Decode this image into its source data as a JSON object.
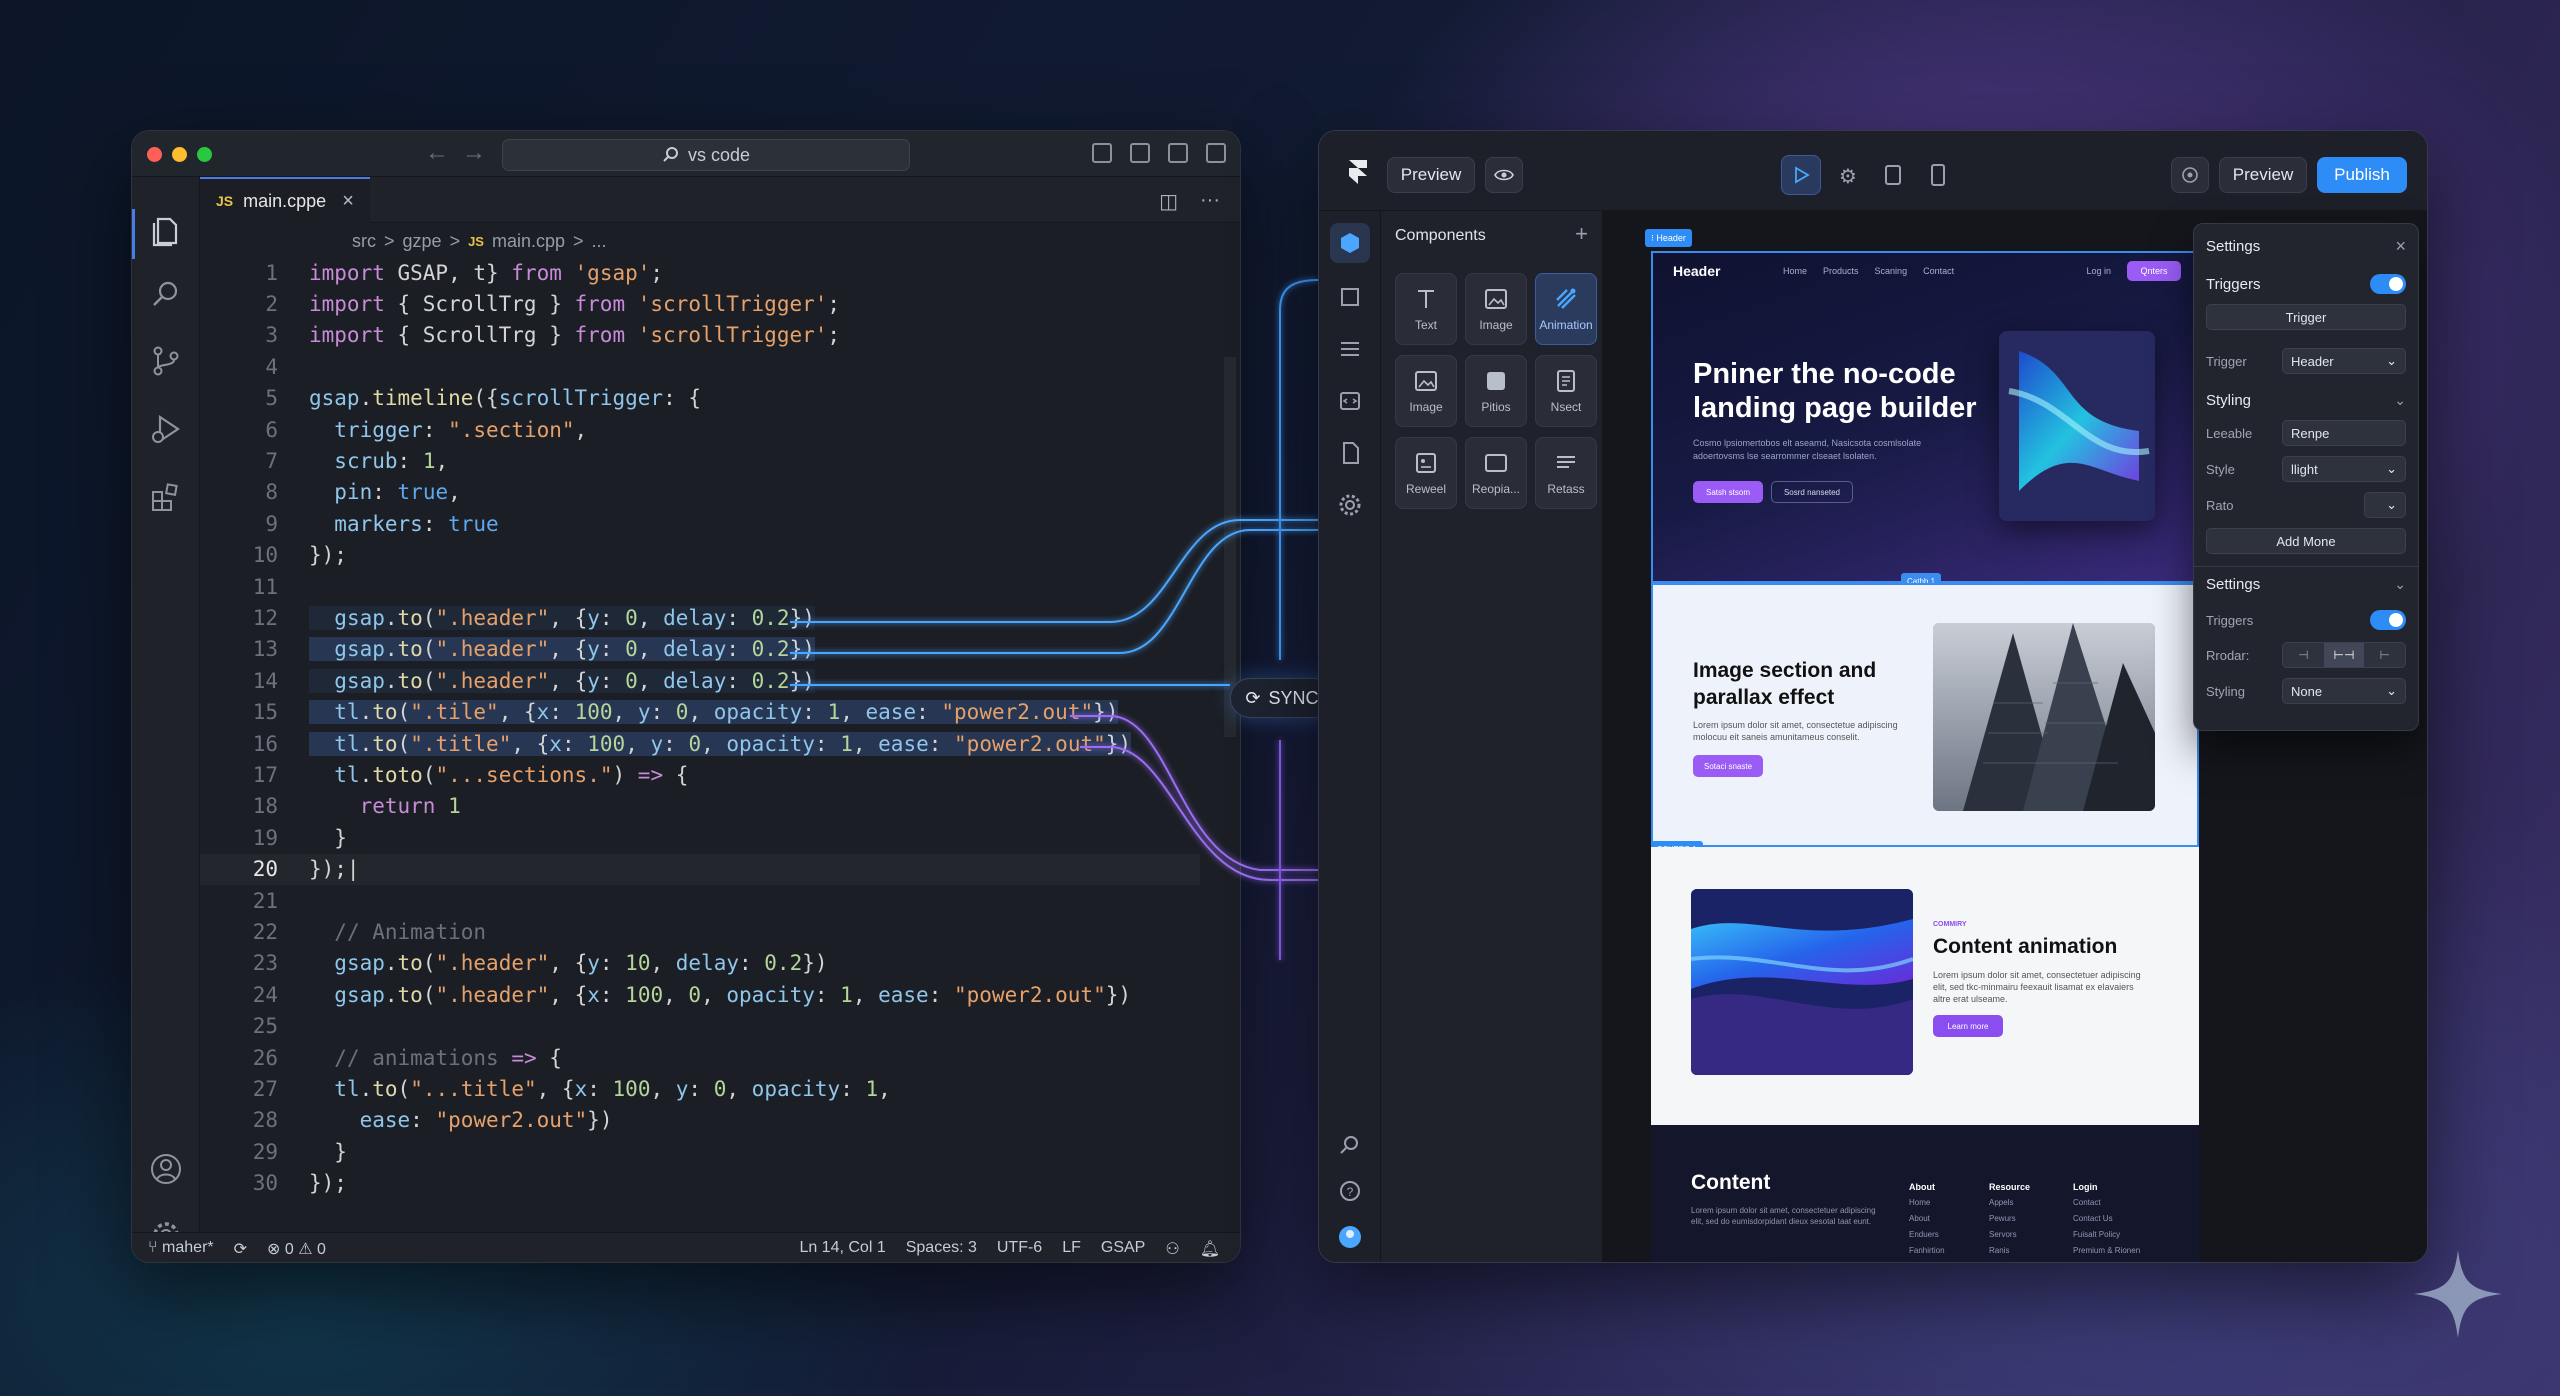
{
  "editor": {
    "title_search": "vs code",
    "tab_label": "main.cppe",
    "tab_badge": "JS",
    "breadcrumb": [
      "src",
      ">",
      "gzpe",
      ">",
      "JS",
      "main.cpp",
      ">",
      "..."
    ],
    "active_line": 20,
    "lines": [
      {
        "n": 1,
        "html": "<span class='kw'>import</span> GSAP, t} <span class='kw'>from</span> <span class='str'>'gsap'</span>;"
      },
      {
        "n": 2,
        "html": "<span class='kw'>import</span> { ScrollTrg } <span class='kw'>from</span> <span class='str'>'scrollTrigger'</span>;"
      },
      {
        "n": 3,
        "html": "<span class='kw'>import</span> { ScrollTrg } <span class='kw'>from</span> <span class='str'>'scrollTrigger'</span>;"
      },
      {
        "n": 4,
        "html": ""
      },
      {
        "n": 5,
        "html": "<span class='var'>gsap</span>.<span class='fn'>timeline</span>({<span class='var'>scrollTrigger</span>: {"
      },
      {
        "n": 6,
        "html": "  <span class='var'>trigger</span>: <span class='str'>\".section\"</span>,"
      },
      {
        "n": 7,
        "html": "  <span class='var'>scrub</span>: <span class='num'>1</span>,"
      },
      {
        "n": 8,
        "html": "  <span class='var'>pin</span>: <span class='bool'>true</span>,"
      },
      {
        "n": 9,
        "html": "  <span class='var'>markers</span>: <span class='bool'>true</span>"
      },
      {
        "n": 10,
        "html": "});"
      },
      {
        "n": 11,
        "html": ""
      },
      {
        "n": 12,
        "hl": 1,
        "html": "  <span class='var'>gsap</span>.<span class='fn'>to</span>(<span class='str'>\".header\"</span>, {<span class='var'>y</span>: <span class='num'>0</span>, <span class='var'>delay</span>: <span class='num'>0.2</span>})"
      },
      {
        "n": 13,
        "hl": 2,
        "html": "  <span class='var'>gsap</span>.<span class='fn'>to</span>(<span class='str'>\".header\"</span>, {<span class='var'>y</span>: <span class='num'>0</span>, <span class='var'>delay</span>: <span class='num'>0.2</span>})"
      },
      {
        "n": 14,
        "hl": 1,
        "html": "  <span class='var'>gsap</span>.<span class='fn'>to</span>(<span class='str'>\".header\"</span>, {<span class='var'>y</span>: <span class='num'>0</span>, <span class='var'>delay</span>: <span class='num'>0.2</span>})"
      },
      {
        "n": 15,
        "hl": 2,
        "html": "  <span class='var'>tl</span>.<span class='fn'>to</span>(<span class='str'>\".tile\"</span>, {<span class='var'>x</span>: <span class='num'>100</span>, <span class='var'>y</span>: <span class='num'>0</span>, <span class='var'>opacity</span>: <span class='num'>1</span>, <span class='var'>ease</span>: <span class='str'>\"power2.out\"</span>})"
      },
      {
        "n": 16,
        "hl": 2,
        "html": "  <span class='var'>tl</span>.<span class='fn'>to</span>(<span class='str'>\".title\"</span>, {<span class='var'>x</span>: <span class='num'>100</span>, <span class='var'>y</span>: <span class='num'>0</span>, <span class='var'>opacity</span>: <span class='num'>1</span>, <span class='var'>ease</span>: <span class='str'>\"power2.out\"</span>})"
      },
      {
        "n": 17,
        "html": "  <span class='var'>tl</span>.<span class='fn'>toto</span>(<span class='str'>\"...sections.\"</span>) <span class='kw'>=&gt;</span> {"
      },
      {
        "n": 18,
        "html": "    <span class='kw'>return</span> <span class='num'>1</span>"
      },
      {
        "n": 19,
        "html": "  }"
      },
      {
        "n": 20,
        "html": "});|"
      },
      {
        "n": 21,
        "html": ""
      },
      {
        "n": 22,
        "html": "  <span class='cmt'>// Animation</span>"
      },
      {
        "n": 23,
        "html": "  <span class='var'>gsap</span>.<span class='fn'>to</span>(<span class='str'>\".header\"</span>, {<span class='var'>y</span>: <span class='num'>10</span>, <span class='var'>delay</span>: <span class='num'>0.2</span>})"
      },
      {
        "n": 24,
        "html": "  <span class='var'>gsap</span>.<span class='fn'>to</span>(<span class='str'>\".header\"</span>, {<span class='var'>x</span>: <span class='num'>100</span>, <span class='num'>0</span>, <span class='var'>opacity</span>: <span class='num'>1</span>, <span class='var'>ease</span>: <span class='str'>\"power2.out\"</span>})"
      },
      {
        "n": 25,
        "html": ""
      },
      {
        "n": 26,
        "html": "  <span class='cmt'>// animations</span> <span class='kw'>=&gt;</span> {"
      },
      {
        "n": 27,
        "html": "  <span class='var'>tl</span>.<span class='fn'>to</span>(<span class='str'>\"...title\"</span>, {<span class='var'>x</span>: <span class='num'>100</span>, <span class='var'>y</span>: <span class='num'>0</span>, <span class='var'>opacity</span>: <span class='num'>1</span>,"
      },
      {
        "n": 28,
        "html": "    <span class='var'>ease</span>: <span class='str'>\"power2.out\"</span>})"
      },
      {
        "n": 29,
        "html": "  }"
      },
      {
        "n": 30,
        "html": "});"
      }
    ],
    "status": {
      "branch": "maher*",
      "problems": "⊗ 0 ⚠ 0",
      "position": "Ln 14, Col 1",
      "spaces": "Spaces: 3",
      "encoding": "UTF-6",
      "eol": "LF",
      "language": "GSAP"
    }
  },
  "sync_label": "SYNC",
  "builder": {
    "preview_left": "Preview",
    "preview_right": "Preview",
    "publish": "Publish",
    "panel_title": "Components",
    "components": [
      {
        "label": "Text",
        "icon": "text-icon"
      },
      {
        "label": "Image",
        "icon": "image-icon"
      },
      {
        "label": "Animation",
        "icon": "animation-icon",
        "active": true
      },
      {
        "label": "Image",
        "icon": "image-icon"
      },
      {
        "label": "Pitios",
        "icon": "square-icon"
      },
      {
        "label": "Nsect",
        "icon": "document-icon"
      },
      {
        "label": "Reweel",
        "icon": "frame-icon"
      },
      {
        "label": "Reopia...",
        "icon": "window-icon"
      },
      {
        "label": "Retass",
        "icon": "lines-icon"
      }
    ],
    "tags": {
      "header": "⁝ Header",
      "cathb": "Cathb.1",
      "scypec": "SCYPEC 1"
    },
    "hero": {
      "logo": "Header",
      "links": [
        "Home",
        "Products",
        "Scaning",
        "Contact"
      ],
      "login": "Log in",
      "cta": "Qnters",
      "title": "Pniner the no-code landing page builder",
      "sub": "Cosmo lpsiomertobos elt aseamd, Nasicsota cosmlsolate adoertovsms lse searrommer clseaet lsolaten.",
      "btn1": "Satsh stsom",
      "btn2": "Sosrd nanseted"
    },
    "section2": {
      "title": "Image section and parallax effect",
      "sub": "Lorem ipsum dolor sit amet, consectetue adipiscing molocuu eit saneis amunitameus conselit.",
      "btn": "Sotaci snaste"
    },
    "section3": {
      "kicker": "COMMIRY",
      "title": "Content animation",
      "sub": "Lorem ipsum dolor sit amet, consectetuer adipiscing elit, sed tkc-minmairu feexauit lisamat ex elavaiers altre erat ulseame.",
      "btn": "Learn more"
    },
    "footer": {
      "title": "Content",
      "sub": "Lorem ipsum dolor sit amet, consectetuer adipiscing elit, sed do eumisdorpidant dieux sesotal taat eunt.",
      "cols": [
        {
          "h": "About",
          "items": [
            "Home",
            "About",
            "Enduers",
            "Fanhirtion"
          ]
        },
        {
          "h": "Resource",
          "items": [
            "Appels",
            "Pewurs",
            "Servors",
            "Ranis"
          ]
        },
        {
          "h": "Login",
          "items": [
            "Contact",
            "Contact Us",
            "Fuisalt Policy",
            "Premium & Rionen"
          ]
        }
      ]
    },
    "settings": {
      "title": "Settings",
      "triggers": "Triggers",
      "trigger_btn": "Trigger",
      "trigger_label": "Trigger",
      "trigger_value": "Header",
      "styling": "Styling",
      "leeable": "Leeable",
      "leeable_value": "Renpe",
      "style": "Style",
      "style_value": "llight",
      "ratio": "Rato",
      "add_more": "Add Mone",
      "settings2": "Settings",
      "triggers2": "Triggers",
      "rodar": "Rrodar:",
      "styling2": "Styling",
      "styling2_value": "None"
    }
  },
  "colors": {
    "accent": "#2e8cf6",
    "purple": "#9b5cf6",
    "highlight": "#3c64aa"
  }
}
